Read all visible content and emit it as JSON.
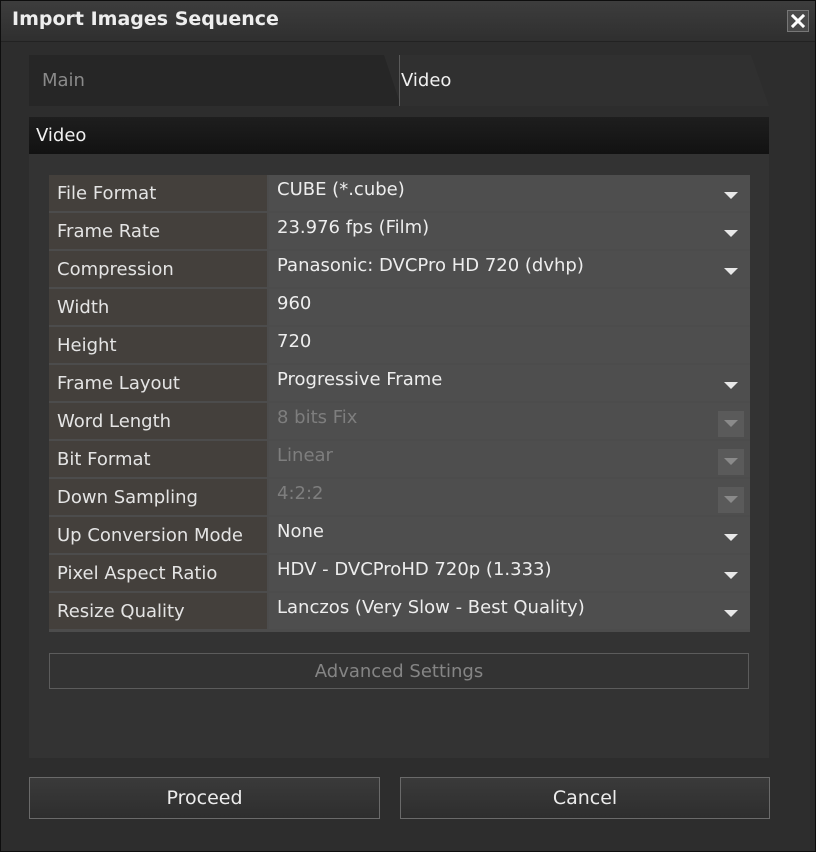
{
  "window": {
    "title": "Import Images Sequence"
  },
  "tabs": [
    {
      "label": "Main",
      "active": false
    },
    {
      "label": "Video",
      "active": true
    }
  ],
  "section": {
    "title": "Video"
  },
  "properties": [
    {
      "label": "File Format",
      "value": "CUBE (*.cube)",
      "enabled": true
    },
    {
      "label": "Frame Rate",
      "value": "23.976 fps (Film)",
      "enabled": true
    },
    {
      "label": "Compression",
      "value": "Panasonic: DVCPro HD 720 (dvhp)",
      "enabled": true
    },
    {
      "label": "Width",
      "value": "960",
      "enabled": true
    },
    {
      "label": "Height",
      "value": "720",
      "enabled": true
    },
    {
      "label": "Frame Layout",
      "value": "Progressive Frame",
      "enabled": true
    },
    {
      "label": "Word Length",
      "value": "8 bits Fix",
      "enabled": false
    },
    {
      "label": "Bit Format",
      "value": "Linear",
      "enabled": false
    },
    {
      "label": "Down Sampling",
      "value": "4:2:2",
      "enabled": false
    },
    {
      "label": "Up Conversion Mode",
      "value": "None",
      "enabled": true
    },
    {
      "label": "Pixel Aspect Ratio",
      "value": "HDV - DVCProHD 720p (1.333)",
      "enabled": true
    },
    {
      "label": "Resize Quality",
      "value": "Lanczos (Very Slow - Best Quality)",
      "enabled": true
    }
  ],
  "advanced_button": {
    "label": "Advanced Settings",
    "enabled": false
  },
  "footer": {
    "proceed_label": "Proceed",
    "cancel_label": "Cancel"
  }
}
